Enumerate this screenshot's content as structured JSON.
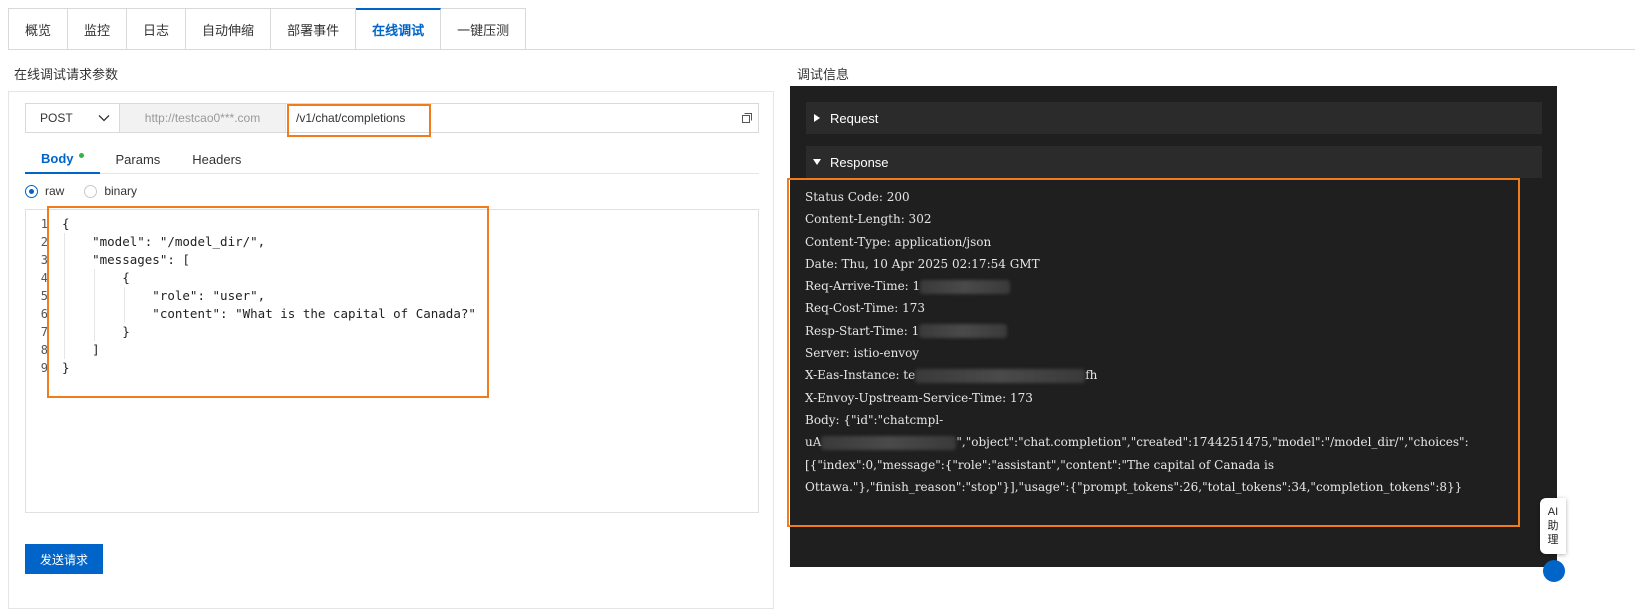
{
  "tabs": [
    {
      "label": "概览"
    },
    {
      "label": "监控"
    },
    {
      "label": "日志"
    },
    {
      "label": "自动伸缩"
    },
    {
      "label": "部署事件"
    },
    {
      "label": "在线调试",
      "active": true
    },
    {
      "label": "一键压测"
    }
  ],
  "left": {
    "title": "在线调试请求参数",
    "method": "POST",
    "host": "http://testcao0***.com",
    "path": "/v1/chat/completions",
    "subtabs": [
      {
        "label": "Body",
        "active": true
      },
      {
        "label": "Params"
      },
      {
        "label": "Headers"
      }
    ],
    "radios": [
      {
        "label": "raw",
        "checked": true
      },
      {
        "label": "binary",
        "checked": false
      }
    ],
    "code_lines": [
      "{",
      "    \"model\": \"/model_dir/\",",
      "    \"messages\": [",
      "        {",
      "            \"role\": \"user\",",
      "            \"content\": \"What is the capital of Canada?\"",
      "        }",
      "    ]",
      "}"
    ],
    "line_numbers": [
      "1",
      "2",
      "3",
      "4",
      "5",
      "6",
      "7",
      "8",
      "9"
    ],
    "send_label": "发送请求"
  },
  "right": {
    "title": "调试信息",
    "request_label": "Request",
    "response_label": "Response",
    "lines": {
      "status": "Status Code: 200",
      "content_length": "Content-Length: 302",
      "content_type": "Content-Type: application/json",
      "date": "Date: Thu, 10 Apr 2025 02:17:54 GMT",
      "req_arrive_prefix": "Req-Arrive-Time: 1",
      "req_cost": "Req-Cost-Time: 173",
      "resp_start_prefix": "Resp-Start-Time: 1",
      "server": "Server: istio-envoy",
      "instance_prefix": "X-Eas-Instance: te",
      "instance_suffix": "fh",
      "upstream": "X-Envoy-Upstream-Service-Time: 173",
      "body_1": "Body: {\"id\":\"chatcmpl-",
      "body_2_prefix": "uA",
      "body_2_suffix": "\",\"object\":\"chat.completion\",\"created\":1744251475,\"model\":\"/model_dir/\",\"choices\":",
      "body_3": "[{\"index\":0,\"message\":{\"role\":\"assistant\",\"content\":\"The capital of Canada is",
      "body_4": "Ottawa.\"},\"finish_reason\":\"stop\"}],\"usage\":{\"prompt_tokens\":26,\"total_tokens\":34,\"completion_tokens\":8}}"
    }
  },
  "ai_helper": {
    "line1": "AI",
    "line2": "助",
    "line3": "理"
  },
  "colors": {
    "accent": "#0064c8",
    "highlight": "#f07c1e",
    "dark_bg": "#1f1f1f",
    "dot": "#2fb54a"
  }
}
